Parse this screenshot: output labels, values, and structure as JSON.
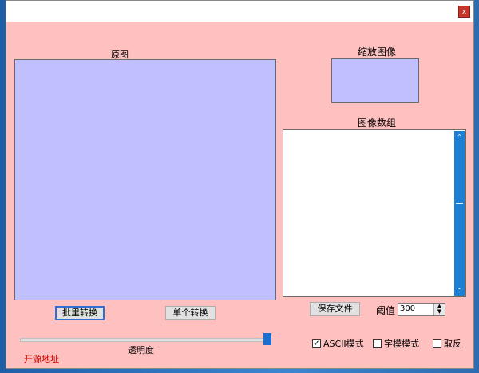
{
  "window": {
    "close_label": "x"
  },
  "original": {
    "label": "原图"
  },
  "scaled": {
    "label": "缩放图像"
  },
  "array": {
    "label": "图像数组"
  },
  "buttons": {
    "batch": "批里转换",
    "single": "单个转换",
    "save": "保存文件"
  },
  "threshold": {
    "label": "阈值",
    "value": "300"
  },
  "transparency": {
    "label": "透明度",
    "value_fraction": 1.0
  },
  "options": {
    "ascii_label": "ASCII模式",
    "ascii_checked": true,
    "glyph_label": "字模模式",
    "glyph_checked": false,
    "invert_label": "取反",
    "invert_checked": false
  },
  "link": {
    "label": "开源地址"
  },
  "colors": {
    "window_bg": "#ffc0c0",
    "image_bg": "#c0c0ff",
    "link": "#d00000",
    "scroll": "#1c7fd6"
  }
}
